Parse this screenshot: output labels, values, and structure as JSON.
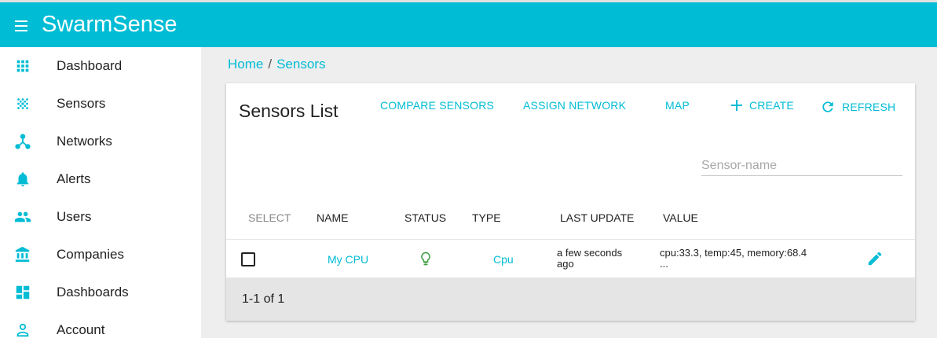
{
  "app": {
    "title": "SwarmSense"
  },
  "sidebar": {
    "items": [
      {
        "label": "Dashboard",
        "icon": "apps-grid-icon"
      },
      {
        "label": "Sensors",
        "icon": "sensor-dots-icon"
      },
      {
        "label": "Networks",
        "icon": "network-icon"
      },
      {
        "label": "Alerts",
        "icon": "bell-icon"
      },
      {
        "label": "Users",
        "icon": "people-icon"
      },
      {
        "label": "Companies",
        "icon": "bank-icon"
      },
      {
        "label": "Dashboards",
        "icon": "dashboard-tiles-icon"
      },
      {
        "label": "Account",
        "icon": "person-icon"
      }
    ]
  },
  "breadcrumb": {
    "home": "Home",
    "separator": "/",
    "current": "Sensors"
  },
  "card": {
    "title": "Sensors List",
    "actions": {
      "compare": "COMPARE SENSORS",
      "assign": "ASSIGN NETWORK",
      "map": "MAP",
      "create": "CREATE",
      "refresh": "REFRESH"
    },
    "search": {
      "placeholder": "Sensor-name",
      "value": ""
    }
  },
  "table": {
    "headers": {
      "select": "SELECT",
      "name": "NAME",
      "status": "STATUS",
      "type": "TYPE",
      "last_update": "LAST UPDATE",
      "value": "VALUE"
    },
    "rows": [
      {
        "name": "My CPU",
        "status": "bulb-icon",
        "type": "Cpu",
        "last_update_line1": "a few seconds",
        "last_update_line2": "ago",
        "value_line1": "cpu:33.3, temp:45, memory:68.4",
        "value_line2": "..."
      }
    ],
    "pagination": "1-1 of 1"
  },
  "colors": {
    "accent": "#00bcd4",
    "status_ok": "#43a047",
    "background": "#eeeeee"
  }
}
